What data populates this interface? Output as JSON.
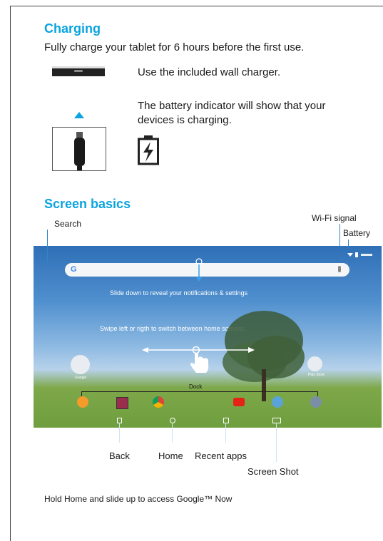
{
  "charging": {
    "title": "Charging",
    "intro": "Fully charge your tablet for 6 hours before the first use.",
    "wall_charger": "Use the included wall charger.",
    "battery_indicator_line1": "The battery indicator will show that your",
    "battery_indicator_line2": "devices is charging."
  },
  "screen_basics": {
    "title": "Screen basics",
    "labels": {
      "search": "Search",
      "wifi": "Wi-Fi signal",
      "battery": "Battery",
      "back": "Back",
      "home": "Home",
      "recent": "Recent apps",
      "screenshot": "Screen Shot"
    },
    "screen": {
      "slide_down": "Slide down to reveal your notifications & settings",
      "swipe": "Swipe left or rigth to switch between home screens",
      "dock": "Dock",
      "google_label": "Google",
      "play_store_label": "Play Store",
      "search_g": "G"
    }
  },
  "footer": "Hold Home and slide up to access Google™ Now"
}
